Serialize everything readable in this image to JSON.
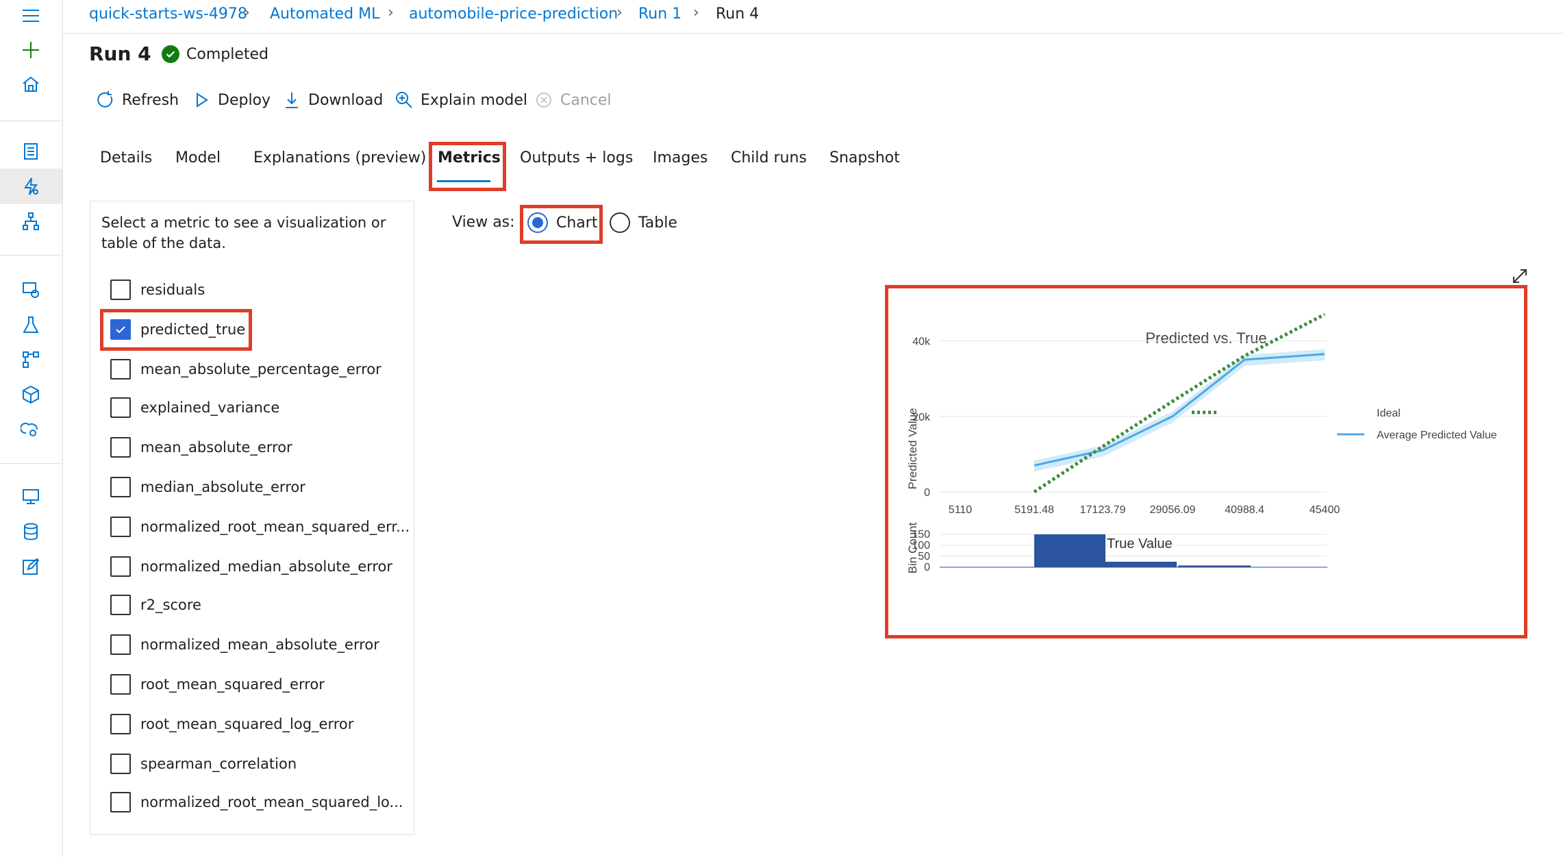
{
  "breadcrumb": [
    "quick-starts-ws-4978",
    "Automated ML",
    "automobile-price-prediction",
    "Run 1",
    "Run 4"
  ],
  "header": {
    "title": "Run 4",
    "status": "Completed"
  },
  "toolbar": {
    "refresh": "Refresh",
    "deploy": "Deploy",
    "download": "Download",
    "explain": "Explain model",
    "cancel": "Cancel"
  },
  "tabs": [
    "Details",
    "Model",
    "Explanations (preview)",
    "Metrics",
    "Outputs + logs",
    "Images",
    "Child runs",
    "Snapshot"
  ],
  "active_tab": "Metrics",
  "metrics_panel": {
    "hint": "Select a metric to see a visualization or table of the data.",
    "items": [
      {
        "label": "residuals",
        "checked": false
      },
      {
        "label": "predicted_true",
        "checked": true
      },
      {
        "label": "mean_absolute_percentage_error",
        "checked": false
      },
      {
        "label": "explained_variance",
        "checked": false
      },
      {
        "label": "mean_absolute_error",
        "checked": false
      },
      {
        "label": "median_absolute_error",
        "checked": false
      },
      {
        "label": "normalized_root_mean_squared_err...",
        "checked": false
      },
      {
        "label": "normalized_median_absolute_error",
        "checked": false
      },
      {
        "label": "r2_score",
        "checked": false
      },
      {
        "label": "normalized_mean_absolute_error",
        "checked": false
      },
      {
        "label": "root_mean_squared_error",
        "checked": false
      },
      {
        "label": "root_mean_squared_log_error",
        "checked": false
      },
      {
        "label": "spearman_correlation",
        "checked": false
      },
      {
        "label": "normalized_root_mean_squared_lo...",
        "checked": false
      }
    ]
  },
  "view_as": {
    "label": "View as:",
    "options": [
      "Chart",
      "Table"
    ],
    "selected": "Chart"
  },
  "colors": {
    "accent": "#0078d4",
    "highlight": "#e03c28",
    "ideal": "#3c8c3c",
    "predicted": "#4aa8e8",
    "bins": "#2c55a0",
    "success": "#107c10"
  },
  "chart_data": {
    "type": "line",
    "title": "Predicted vs. True",
    "ylabel": "Predicted Value",
    "ylabel_bottom": "Bin Count",
    "hist_label": "True Value",
    "x_ticks": [
      "5110",
      "5191.48",
      "17123.79",
      "29056.09",
      "40988.4",
      "45400"
    ],
    "y_ticks": [
      "0",
      "20k",
      "40k"
    ],
    "hist_y_ticks": [
      "0",
      "50",
      "100",
      "150"
    ],
    "ylim": [
      0,
      45000
    ],
    "legend_position": "right",
    "series": [
      {
        "name": "Ideal",
        "style": "dotted",
        "x": [
          5191.48,
          17123.79,
          29056.09,
          40988.4,
          45400
        ],
        "y": [
          0,
          12000,
          24000,
          36000,
          47000
        ]
      },
      {
        "name": "Average Predicted Value",
        "style": "solid",
        "x": [
          5191.48,
          17123.79,
          29056.09,
          40988.4,
          45400
        ],
        "y": [
          7000,
          11000,
          20000,
          35000,
          36500
        ]
      }
    ],
    "bins": [
      {
        "bin": 1,
        "count": 150
      },
      {
        "bin": 2,
        "count": 25
      },
      {
        "bin": 3,
        "count": 8
      }
    ]
  }
}
